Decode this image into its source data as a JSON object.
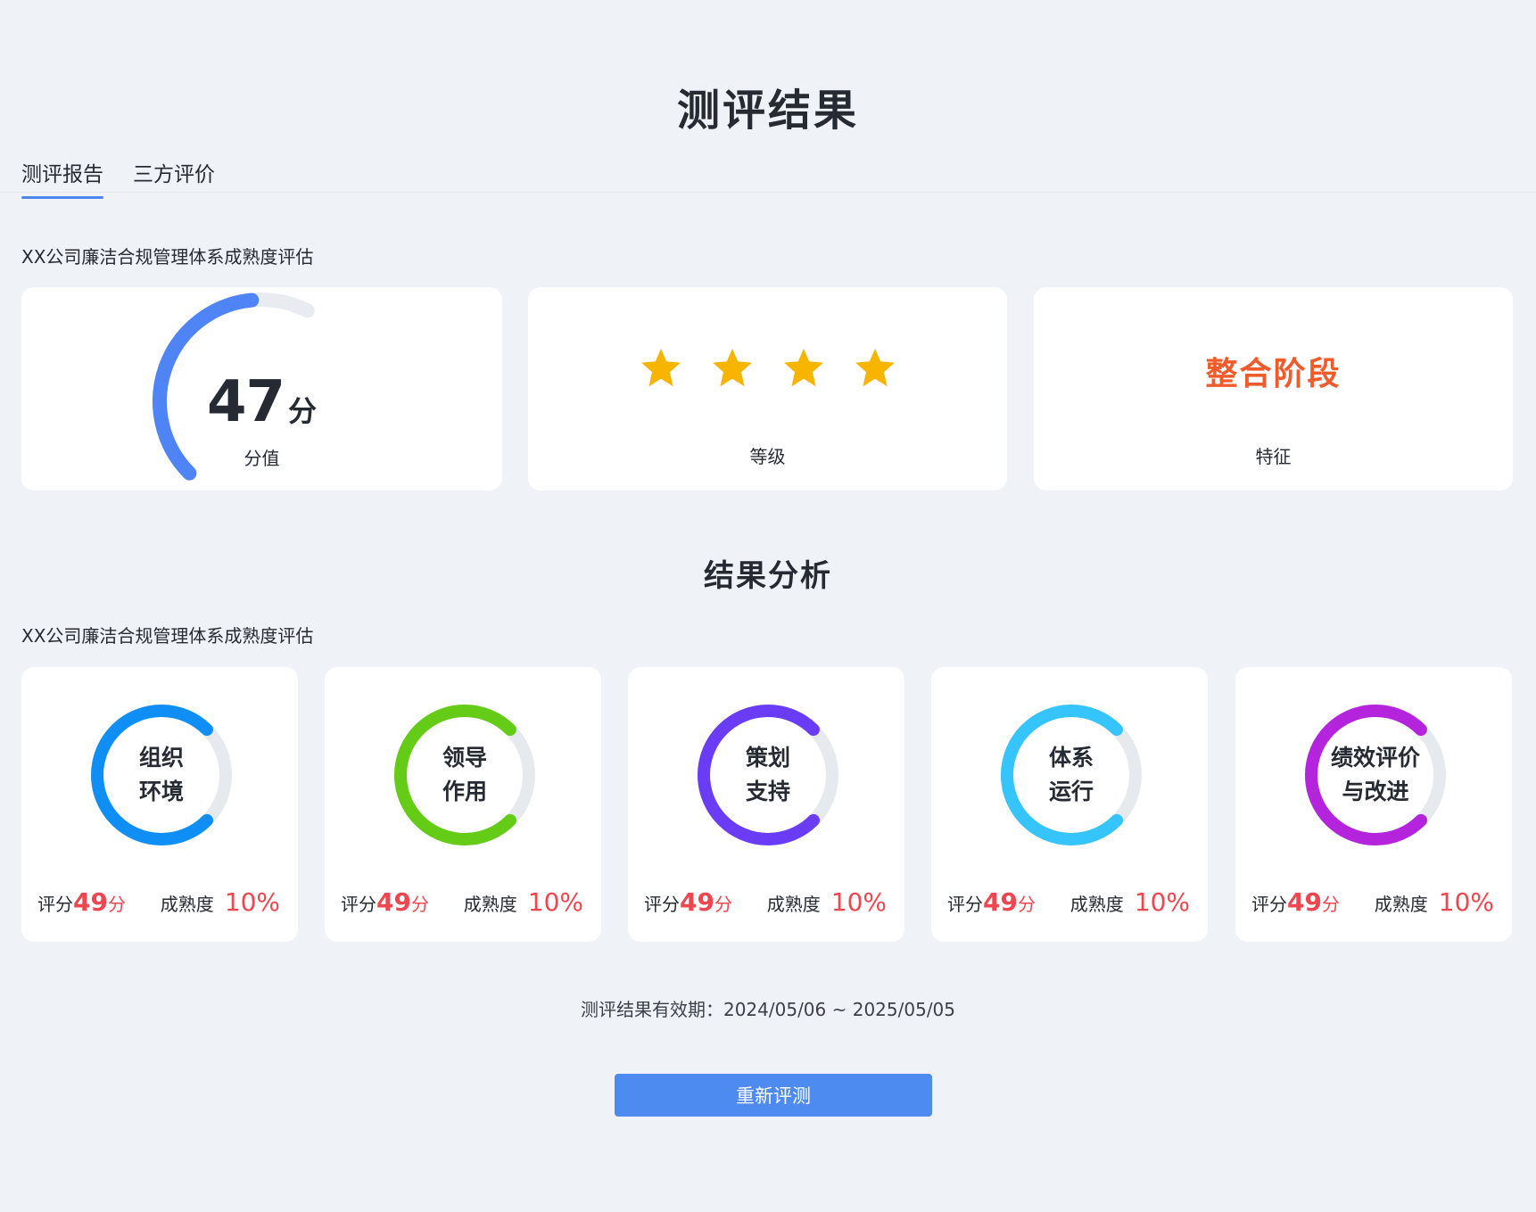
{
  "page": {
    "title": "测评结果"
  },
  "tabs": [
    {
      "label": "测评报告",
      "active": true
    },
    {
      "label": "三方评价",
      "active": false
    }
  ],
  "report": {
    "subtitle": "XX公司廉洁合规管理体系成熟度评估",
    "score": {
      "value": "47",
      "unit": "分",
      "label": "分值",
      "fraction": 0.47,
      "color": "#4f84f6"
    },
    "grade": {
      "stars": 4,
      "label": "等级",
      "star_color": "#f7b500"
    },
    "feature": {
      "value": "整合阶段",
      "label": "特征",
      "color": "#f05b2b"
    }
  },
  "analysis": {
    "title": "结果分析",
    "subtitle": "XX公司廉洁合规管理体系成熟度评估",
    "score_prefix": "评分",
    "maturity_label": "成熟度",
    "items": [
      {
        "line1": "组织",
        "line2": "环境",
        "score": "49",
        "score_unit": "分",
        "maturity": "10%",
        "fraction": 0.75,
        "color": "#0f8ff5",
        "icon": "ring-progress-icon"
      },
      {
        "line1": "领导",
        "line2": "作用",
        "score": "49",
        "score_unit": "分",
        "maturity": "10%",
        "fraction": 0.75,
        "color": "#64cc16",
        "icon": "ring-progress-icon"
      },
      {
        "line1": "策划",
        "line2": "支持",
        "score": "49",
        "score_unit": "分",
        "maturity": "10%",
        "fraction": 0.75,
        "color": "#6b3cf5",
        "icon": "ring-progress-icon"
      },
      {
        "line1": "体系",
        "line2": "运行",
        "score": "49",
        "score_unit": "分",
        "maturity": "10%",
        "fraction": 0.75,
        "color": "#35c4fb",
        "icon": "ring-progress-icon"
      },
      {
        "line1": "绩效评价",
        "line2": "与改进",
        "score": "49",
        "score_unit": "分",
        "maturity": "10%",
        "fraction": 0.75,
        "color": "#b424dd",
        "icon": "ring-progress-icon"
      }
    ]
  },
  "validity": {
    "text": "测评结果有效期：2024/05/06 ~ 2025/05/05"
  },
  "actions": {
    "retest_label": "重新评测"
  }
}
